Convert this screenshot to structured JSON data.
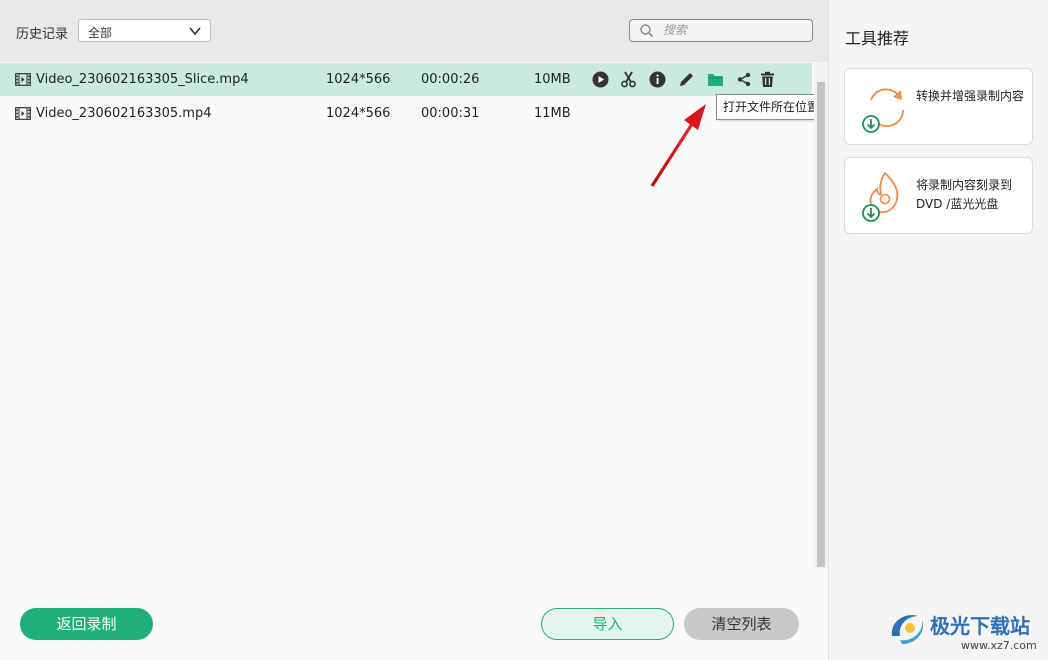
{
  "header": {
    "history_label": "历史记录",
    "filter_value": "全部",
    "search_placeholder": "搜索"
  },
  "rows": [
    {
      "name": "Video_230602163305_Slice.mp4",
      "resolution": "1024*566",
      "duration": "00:00:26",
      "size": "10MB",
      "selected": true
    },
    {
      "name": "Video_230602163305.mp4",
      "resolution": "1024*566",
      "duration": "00:00:31",
      "size": "11MB",
      "selected": false
    }
  ],
  "row_actions": [
    "play-icon",
    "scissors-icon",
    "info-icon",
    "pencil-icon",
    "folder-icon",
    "share-icon",
    "trash-icon"
  ],
  "tooltip": "打开文件所在位置",
  "buttons": {
    "back": "返回录制",
    "import": "导入",
    "clear": "清空列表"
  },
  "sidebar": {
    "title": "工具推荐",
    "cards": [
      {
        "text": "转换并增强录制内容",
        "icon": "convert-icon"
      },
      {
        "text": "将录制内容刻录到 DVD /蓝光光盘",
        "icon": "burn-disc-icon"
      }
    ]
  },
  "watermark": {
    "text": "极光下载站",
    "url": "www.xz7.com"
  },
  "colors": {
    "accent": "#1fb07a",
    "selected_row": "#c9eadf",
    "arrow": "#d9161b",
    "watermark": "#2e6fb5",
    "card_orange": "#f08b4a"
  }
}
